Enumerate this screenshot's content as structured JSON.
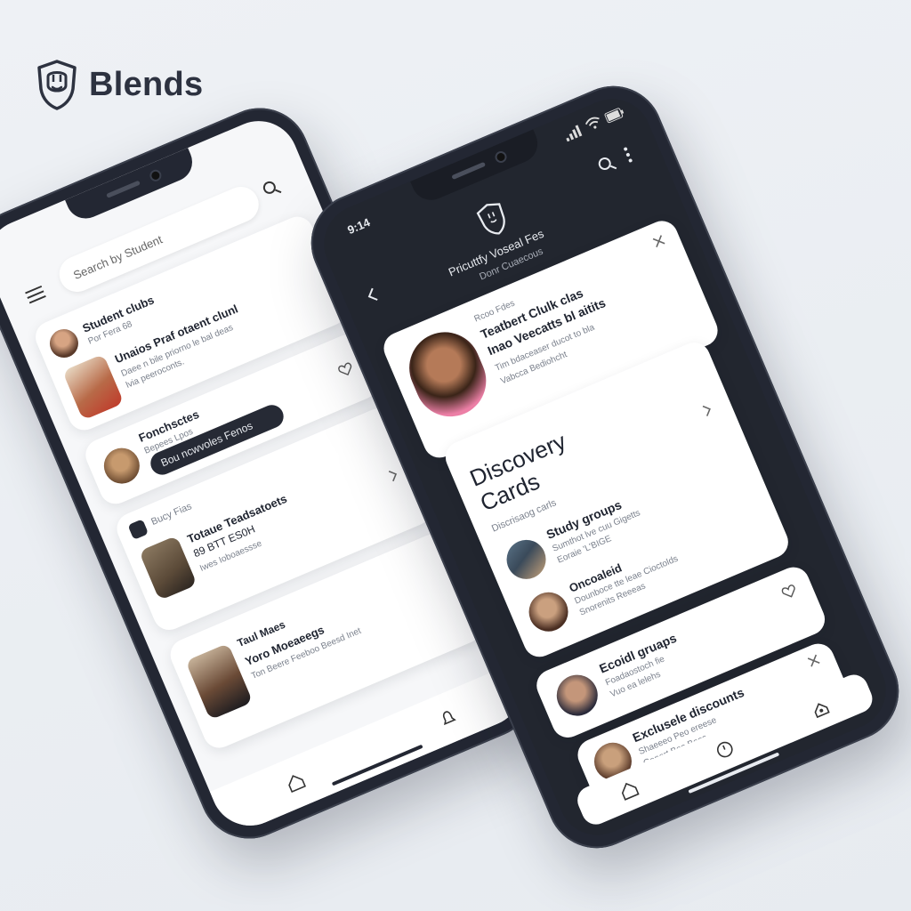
{
  "brand": {
    "name": "Blends",
    "logo_icon": "shield-mascot-icon"
  },
  "left_phone": {
    "search_placeholder": "Search by Student",
    "items": [
      {
        "title": "Student clubs",
        "sub": "Por Fera 68"
      },
      {
        "title": "Unaios Praf otaent clunl",
        "sub": "Daee n bile priorno le bal deas",
        "sub2": "lvia peeroconts."
      },
      {
        "title": "Fonchsctes",
        "sub": "Bepees Lpos",
        "pill": "Bou ncwvoles Fenos"
      },
      {
        "title": "Bucy Fias",
        "sub": ""
      },
      {
        "title": "Totaue Teadsatoets",
        "sub": "89 BTT ES0H",
        "sub2": "Iwes Ioboaessse"
      },
      {
        "title": "Taul Maes",
        "sub": ""
      },
      {
        "title": "Yoro Moeaeegs",
        "sub": "Ton Beere Feeboo Beesd Inet"
      }
    ]
  },
  "right_phone": {
    "time": "9:14",
    "header_title": "Pricuttfy Voseal Fes",
    "header_sub": "Donr Cuaecous",
    "top_card": {
      "label": "Rcoo Fdes",
      "title": "Teatbert Clulk clas",
      "title2": "Inao Veecatts bl aitits",
      "sub": "Tim bdaceaser ducot to bla",
      "sub2": "Vabcca Bediohcht"
    },
    "discovery_title": "Discovery Cards",
    "discovery_sub": "Discrisaog carls",
    "discovery_items": [
      {
        "title": "Study groups",
        "sub": "Sumthot lve cuu Gigetts",
        "sub2": "Eoraie 'L'BIGE"
      },
      {
        "title": "Oncoaleid",
        "sub": "Dounboce tte leae Cioctolds",
        "sub2": "Snorenits Reeeas"
      }
    ],
    "card_events": {
      "title": "Ecoidl gruaps",
      "sub": "Foadaostoch fie",
      "sub2": "Vuo ea lelehs"
    },
    "card_discounts": {
      "title": "Exclusele discounts",
      "sub": "Shaeeeo Peo ereese",
      "sub2": "Gonort Boa Bees"
    }
  },
  "colors": {
    "phone_body": "#232733",
    "screen_light": "#f6f7f9",
    "card": "#ffffff",
    "accent_pink": "#ec7fa6",
    "text_dark": "#1f2430"
  }
}
